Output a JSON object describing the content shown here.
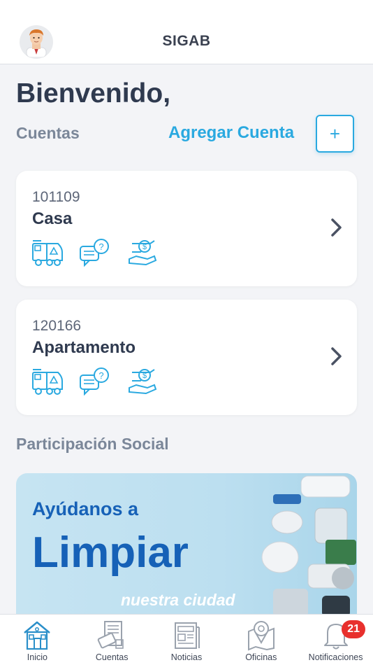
{
  "header": {
    "title": "SIGAB",
    "avatar_icon": "user-avatar-icon"
  },
  "welcome": "Bienvenido,",
  "accounts_section": {
    "label": "Cuentas",
    "add_label": "Agregar Cuenta",
    "add_button": "+"
  },
  "accounts": [
    {
      "number": "101109",
      "name": "Casa"
    },
    {
      "number": "120166",
      "name": "Apartamento"
    }
  ],
  "social_section": {
    "label": "Participación Social"
  },
  "banner": {
    "line1": "Ayúdanos a",
    "line2": "Limpiar",
    "line3": "nuestra ciudad"
  },
  "tabs": [
    {
      "label": "Inicio",
      "icon": "home-icon"
    },
    {
      "label": "Cuentas",
      "icon": "receipt-card-icon"
    },
    {
      "label": "Noticias",
      "icon": "newspaper-icon"
    },
    {
      "label": "Oficinas",
      "icon": "map-pin-icon"
    },
    {
      "label": "Notificaciones",
      "icon": "bell-icon",
      "badge": "21"
    }
  ],
  "colors": {
    "accent": "#2aa9e0",
    "active_tab": "#2a8fc9",
    "badge": "#e8302d",
    "banner_text": "#1661b7"
  }
}
